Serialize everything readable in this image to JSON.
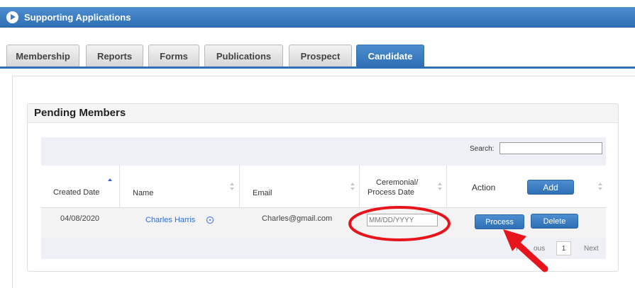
{
  "header": {
    "title": "Supporting Applications",
    "icon": "play-circle-icon"
  },
  "tabs": [
    {
      "label": "Membership",
      "active": false
    },
    {
      "label": "Reports",
      "active": false
    },
    {
      "label": "Forms",
      "active": false
    },
    {
      "label": "Publications",
      "active": false
    },
    {
      "label": "Prospect",
      "active": false
    },
    {
      "label": "Candidate",
      "active": true
    }
  ],
  "panel": {
    "title": "Pending Members"
  },
  "search": {
    "label": "Search:",
    "value": ""
  },
  "table": {
    "columns": [
      "Created Date",
      "Name",
      "Email",
      "Ceremonial/",
      "Process Date",
      "Action"
    ],
    "sorted_column": "Created Date",
    "sort_direction": "ascending",
    "add_label": "Add",
    "rows": [
      {
        "created_date": "04/08/2020",
        "name": "Charles Harris",
        "email": "Charles@gmail.com",
        "date_placeholder": "MM/DD/YYYY",
        "process_label": "Process",
        "delete_label": "Delete"
      }
    ]
  },
  "pagination": {
    "previous_visible": "Pre",
    "previous_tail": "ous",
    "current_page": "1",
    "next": "Next"
  },
  "colors": {
    "accent": "#2f6fb4",
    "annotation": "#e8141c",
    "link": "#2f6fd6"
  }
}
